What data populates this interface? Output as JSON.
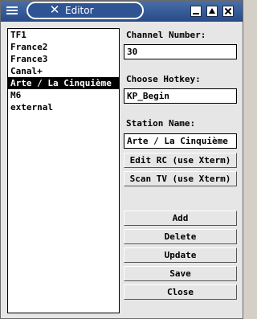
{
  "window": {
    "title": "Editor"
  },
  "stations": [
    "TF1",
    "France2",
    "France3",
    "Canal+",
    "Arte / La Cinquième",
    "M6",
    "external"
  ],
  "selected_index": 4,
  "channel": {
    "label": "Channel Number:",
    "value": "30"
  },
  "hotkey": {
    "label": "Choose Hotkey:",
    "value": "KP_Begin"
  },
  "station_name": {
    "label": "Station Name:",
    "value": "Arte / La Cinquième"
  },
  "buttons": {
    "edit_rc": "Edit RC (use Xterm)",
    "scan_tv": "Scan TV (use Xterm)",
    "add": "Add",
    "delete": "Delete",
    "update": "Update",
    "save": "Save",
    "close": "Close"
  }
}
